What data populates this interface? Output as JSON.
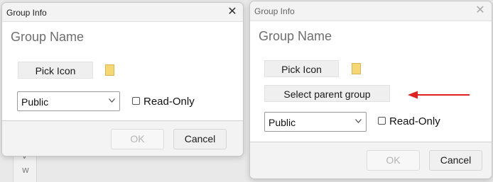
{
  "background": {
    "list_letters": [
      "V",
      "W"
    ]
  },
  "dialog_left": {
    "title": "Group Info",
    "name_placeholder": "Group Name",
    "pick_icon_label": "Pick Icon",
    "visibility_value": "Public",
    "readonly_label": "Read-Only",
    "ok_label": "OK",
    "cancel_label": "Cancel"
  },
  "dialog_right": {
    "title": "Group Info",
    "name_placeholder": "Group Name",
    "pick_icon_label": "Pick Icon",
    "select_parent_label": "Select parent group",
    "visibility_value": "Public",
    "readonly_label": "Read-Only",
    "ok_label": "OK",
    "cancel_label": "Cancel"
  },
  "colors": {
    "arrow": "#e02020",
    "folder": "#f7d774"
  }
}
